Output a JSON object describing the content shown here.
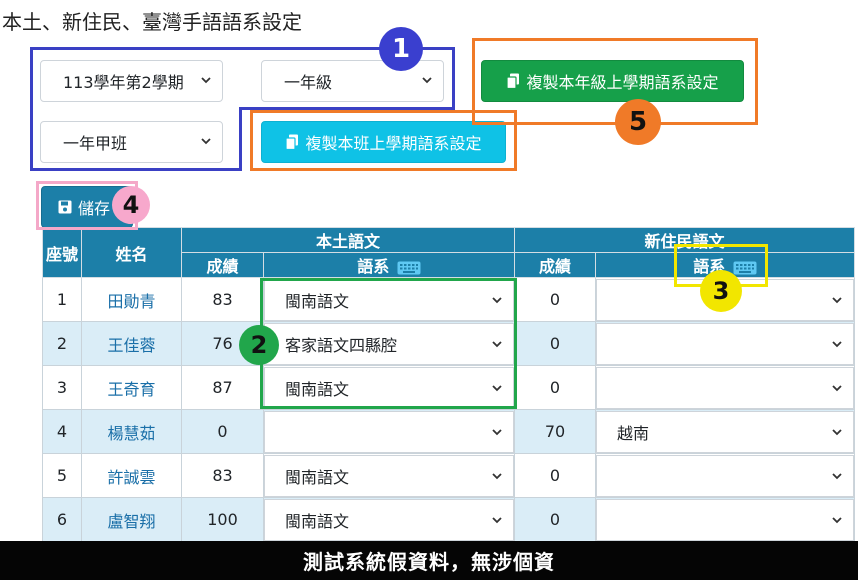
{
  "page": {
    "title": "本土、新住民、臺灣手語語系設定"
  },
  "filters": {
    "semester": "113學年第2學期",
    "grade": "一年級",
    "class": "一年甲班"
  },
  "buttons": {
    "copy_grade": "複製本年級上學期語系設定",
    "copy_class": "複製本班上學期語系設定",
    "save": "儲存"
  },
  "badges": {
    "b1": "1",
    "b2": "2",
    "b3": "3",
    "b4": "4",
    "b5": "5"
  },
  "table": {
    "headers": {
      "seat": "座號",
      "name": "姓名",
      "local": "本土語文",
      "newimm": "新住民語文",
      "score": "成績",
      "lang": "語系",
      "score2": "成績",
      "lang2": "語系"
    },
    "rows": [
      {
        "seat": "1",
        "name": "田勛青",
        "local_score": "83",
        "local_lang": "閩南語文",
        "new_score": "0",
        "new_lang": ""
      },
      {
        "seat": "2",
        "name": "王佳蓉",
        "local_score": "76",
        "local_lang": "客家語文四縣腔",
        "new_score": "0",
        "new_lang": ""
      },
      {
        "seat": "3",
        "name": "王奇育",
        "local_score": "87",
        "local_lang": "閩南語文",
        "new_score": "0",
        "new_lang": ""
      },
      {
        "seat": "4",
        "name": "楊慧茹",
        "local_score": "0",
        "local_lang": "",
        "new_score": "70",
        "new_lang": "越南"
      },
      {
        "seat": "5",
        "name": "許誠雲",
        "local_score": "83",
        "local_lang": "閩南語文",
        "new_score": "0",
        "new_lang": ""
      },
      {
        "seat": "6",
        "name": "盧智翔",
        "local_score": "100",
        "local_lang": "閩南語文",
        "new_score": "0",
        "new_lang": ""
      }
    ]
  },
  "footer": {
    "notice": "測試系統假資料，無涉個資"
  },
  "colors": {
    "header_blue": "#1c7fa8",
    "green_button": "#16a04a",
    "cyan_button": "#0fc2e6",
    "frame_navy": "#3a40c4",
    "frame_orange": "#f07a28",
    "frame_green": "#21a64b",
    "frame_yellow": "#f2e600",
    "frame_pink": "#f4a8c8"
  },
  "icons": {
    "copy": "copy-icon",
    "save": "floppy-disk-icon",
    "keyboard": "keyboard-icon",
    "dropdown": "chevron-down-icon"
  }
}
